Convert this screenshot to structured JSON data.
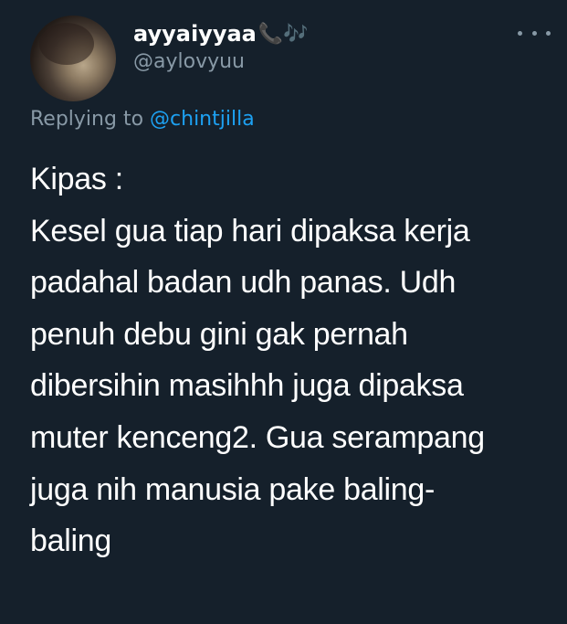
{
  "user": {
    "display_name": "ayyaiyyaa",
    "name_emoji": "📞🎶",
    "handle": "@aylovyuu"
  },
  "reply": {
    "prefix": "Replying to",
    "mention": "@chintjilla"
  },
  "tweet": {
    "lines": [
      "Kipas :",
      "Kesel gua tiap hari dipaksa kerja",
      "padahal badan udh panas. Udh",
      "penuh debu gini gak pernah",
      "dibersihin masihhh juga dipaksa",
      "muter kenceng2. Gua serampang",
      "juga nih manusia pake baling-",
      "baling"
    ]
  },
  "colors": {
    "background": "#15202b",
    "text": "#ffffff",
    "secondary": "#8899a6",
    "accent": "#1da1f2"
  },
  "icons": {
    "more": "more-horizontal-icon"
  }
}
